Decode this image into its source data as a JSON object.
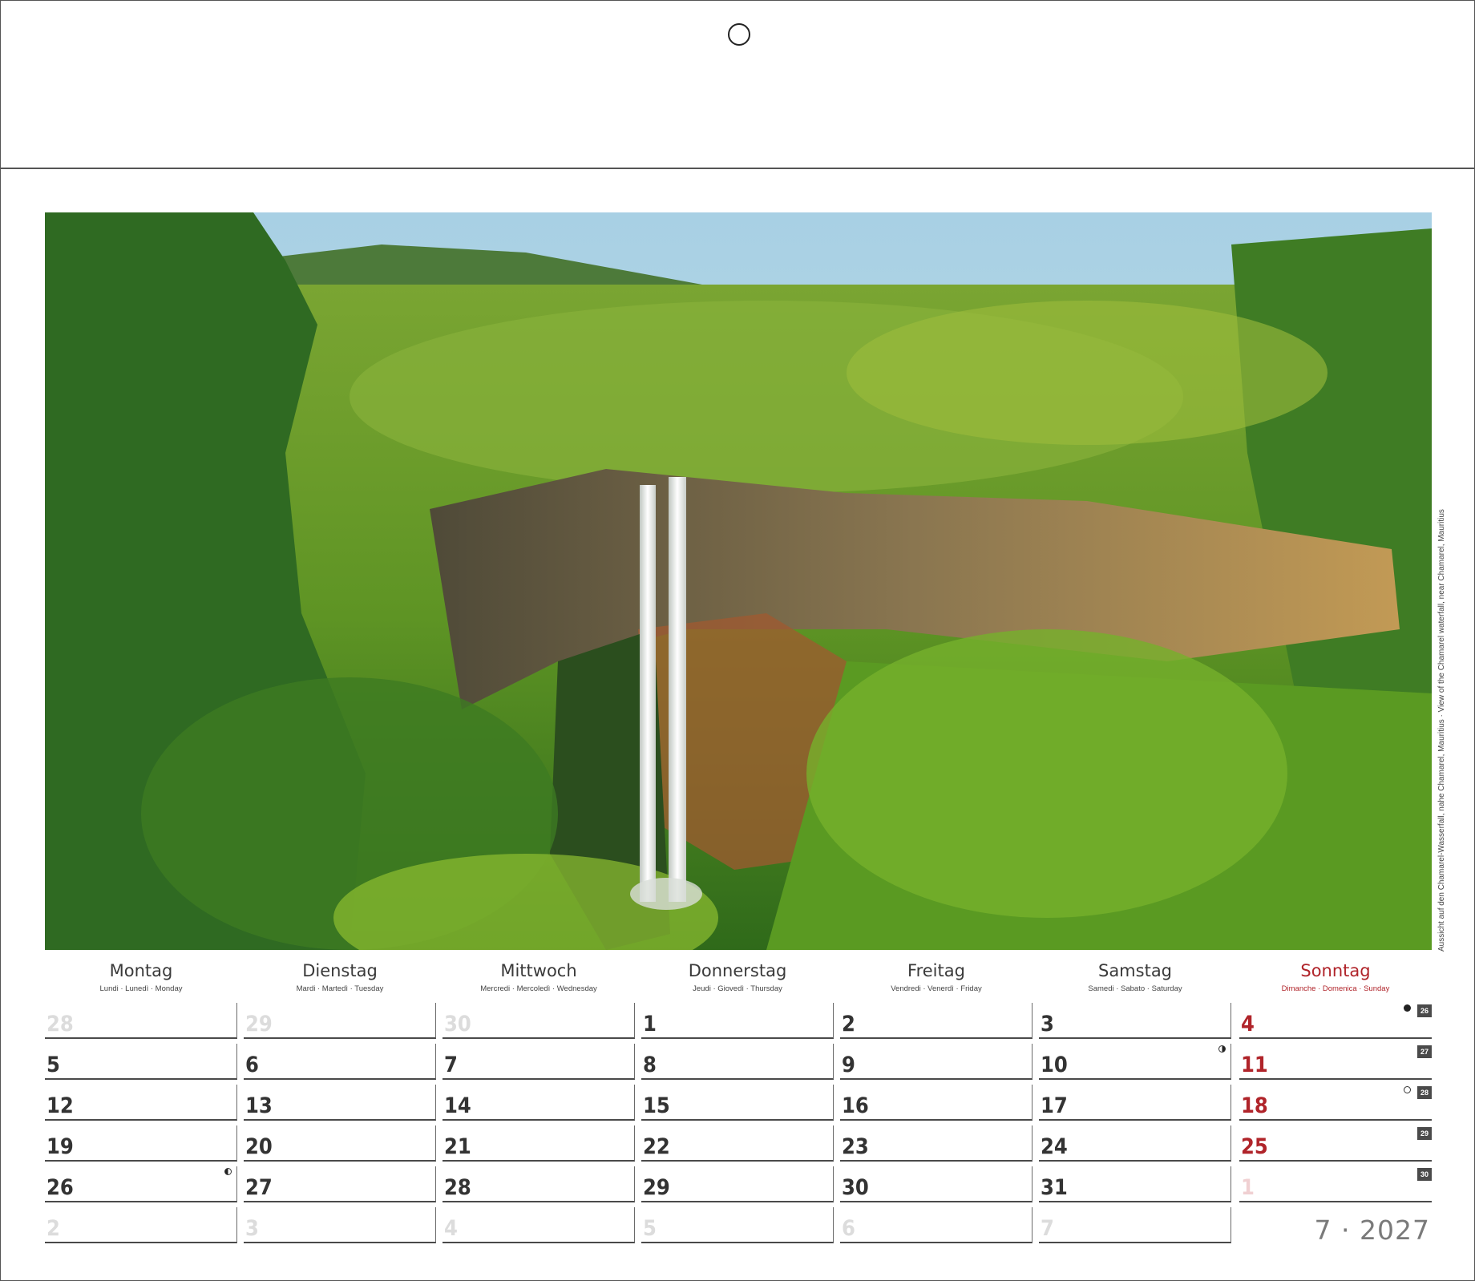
{
  "caption": "Aussicht auf den Chamarel-Wasserfall, nahe Chamarel, Mauritius · View of the Chamarel waterfall, near Chamarel, Mauritius",
  "weekdays": [
    {
      "name": "Montag",
      "sub": "Lundi · Lunedì · Monday"
    },
    {
      "name": "Dienstag",
      "sub": "Mardi · Martedì · Tuesday"
    },
    {
      "name": "Mittwoch",
      "sub": "Mercredi · Mercoledì · Wednesday"
    },
    {
      "name": "Donnerstag",
      "sub": "Jeudi · Giovedì · Thursday"
    },
    {
      "name": "Freitag",
      "sub": "Vendredi · Venerdì · Friday"
    },
    {
      "name": "Samstag",
      "sub": "Samedi · Sabato · Saturday"
    },
    {
      "name": "Sonntag",
      "sub": "Dimanche · Domenica · Sunday"
    }
  ],
  "weeks": [
    {
      "kw": "26",
      "days": [
        "28",
        "29",
        "30",
        "1",
        "2",
        "3",
        "4"
      ],
      "other": [
        true,
        true,
        true,
        false,
        false,
        false,
        false
      ]
    },
    {
      "kw": "27",
      "days": [
        "5",
        "6",
        "7",
        "8",
        "9",
        "10",
        "11"
      ],
      "other": [
        false,
        false,
        false,
        false,
        false,
        false,
        false
      ]
    },
    {
      "kw": "28",
      "days": [
        "12",
        "13",
        "14",
        "15",
        "16",
        "17",
        "18"
      ],
      "other": [
        false,
        false,
        false,
        false,
        false,
        false,
        false
      ]
    },
    {
      "kw": "29",
      "days": [
        "19",
        "20",
        "21",
        "22",
        "23",
        "24",
        "25"
      ],
      "other": [
        false,
        false,
        false,
        false,
        false,
        false,
        false
      ]
    },
    {
      "kw": "30",
      "days": [
        "26",
        "27",
        "28",
        "29",
        "30",
        "31",
        "1"
      ],
      "other": [
        false,
        false,
        false,
        false,
        false,
        false,
        true
      ]
    },
    {
      "kw": "",
      "days": [
        "2",
        "3",
        "4",
        "5",
        "6",
        "7",
        ""
      ],
      "other": [
        true,
        true,
        true,
        true,
        true,
        true,
        true
      ]
    }
  ],
  "moon_phases": [
    {
      "week": 0,
      "col": 6,
      "phase": "new"
    },
    {
      "week": 1,
      "col": 5,
      "phase": "first-quarter"
    },
    {
      "week": 2,
      "col": 6,
      "phase": "full"
    },
    {
      "week": 4,
      "col": 0,
      "phase": "last-quarter"
    }
  ],
  "month_year": "7 · 2027",
  "colors": {
    "sunday": "#b0242a",
    "text": "#3a3a3a",
    "muted": "#dcdcdc",
    "badge": "#4a4a4a"
  }
}
